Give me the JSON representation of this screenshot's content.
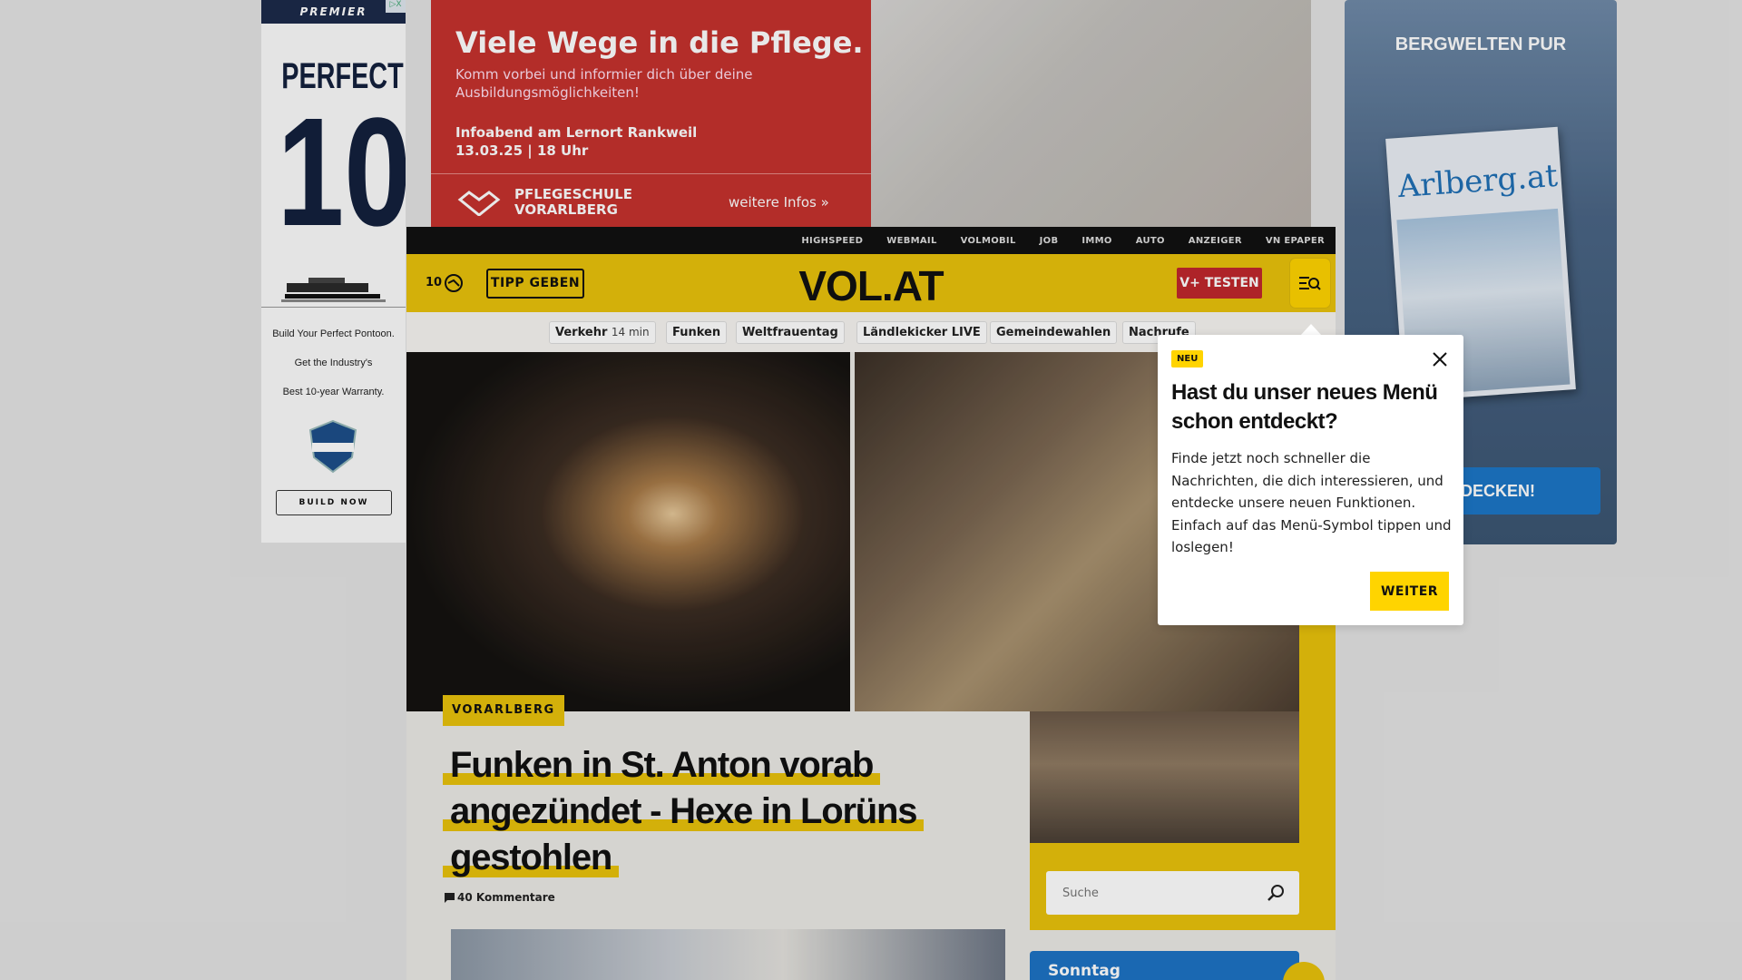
{
  "left_ad": {
    "brand": "PREMIER",
    "adchoices": "▷X",
    "headline_small": "PERFECT",
    "headline_big": "10",
    "lines": [
      "Build Your Perfect Pontoon.",
      "Get the Industry's",
      "Best 10-year Warranty."
    ],
    "button": "BUILD NOW"
  },
  "top_ad": {
    "headline": "Viele Wege in die Pflege.",
    "subline": "Komm vorbei und informier dich über deine Ausbildungsmöglichkeiten!",
    "event": "Infoabend am Lernort Rankweil",
    "date": "13.03.25 | 18 Uhr",
    "school": "PFLEGESCHULE VORARLBERG",
    "more": "weitere Infos »"
  },
  "right_ad": {
    "title": "BERGWELTEN PUR",
    "magazine": "Arlberg.at",
    "cta": "ENTDECKEN!"
  },
  "topnav": {
    "items": [
      "HIGHSPEED",
      "WEBMAIL",
      "VOLMOBIL",
      "JOB",
      "IMMO",
      "AUTO",
      "ANZEIGER",
      "VN EPAPER"
    ]
  },
  "header": {
    "count": "10",
    "tipp": "TIPP GEBEN",
    "logo": "VOL.AT",
    "vplus": "V+ TESTEN"
  },
  "topics": [
    {
      "label": "Verkehr",
      "sub": "14 min"
    },
    {
      "label": "Funken"
    },
    {
      "label": "Weltfrauentag"
    },
    {
      "label": "Ländlekicker LIVE"
    },
    {
      "label": "Gemeindewahlen"
    },
    {
      "label": "Nachrufe"
    }
  ],
  "article": {
    "category": "VORARLBERG",
    "title": "Funken in St. Anton vorab angezündet - Hexe in Lorüns gestohlen",
    "comments": "40 Kommentare"
  },
  "search": {
    "placeholder": "Suche"
  },
  "sidebar": {
    "sunday": "Sonntag"
  },
  "popup": {
    "badge": "NEU",
    "title": "Hast du unser neues Menü schon entdeckt?",
    "body": "Finde jetzt noch schneller die Nachrichten, die dich interessieren, und entdecke unsere neuen Funktionen. Einfach auf das Menü-Symbol tippen und loslegen!",
    "button": "WEITER"
  },
  "colors": {
    "brand_yellow": "#e8c20b",
    "popup_yellow": "#ffd400",
    "vplus_red": "#c0272d",
    "ad_red": "#c5322e"
  }
}
